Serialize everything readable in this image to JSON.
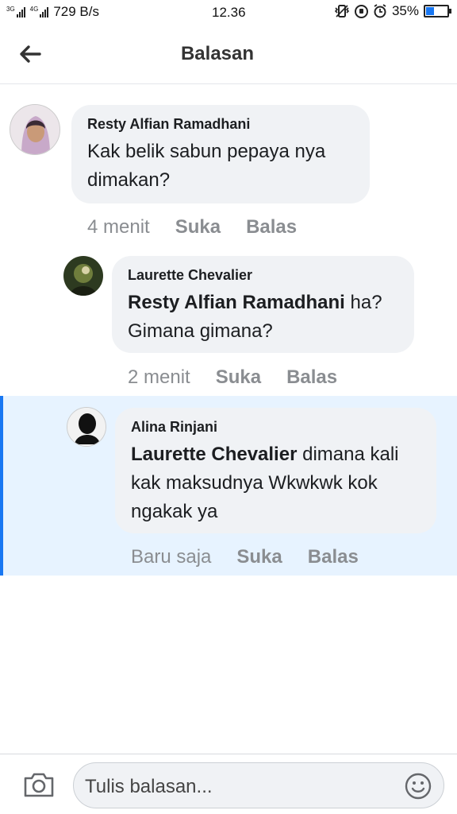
{
  "status_bar": {
    "net_label_1": "3G",
    "net_label_2": "4G",
    "speed": "729 B/s",
    "time": "12.36",
    "battery_text": "35%",
    "battery_level": 0.35
  },
  "header": {
    "title": "Balasan"
  },
  "comments": [
    {
      "author": "Resty Alfian Ramadhani",
      "mention": "",
      "text": "Kak belik sabun pepaya nya dimakan?",
      "time": "4 menit",
      "like_label": "Suka",
      "reply_label": "Balas"
    },
    {
      "author": "Laurette Chevalier",
      "mention": "Resty Alfian Ramadhani",
      "text": " ha? Gimana gimana?",
      "time": "2 menit",
      "like_label": "Suka",
      "reply_label": "Balas"
    },
    {
      "author": "Alina Rinjani",
      "mention": "Laurette Chevalier",
      "text": " dimana kali kak maksudnya Wkwkwk kok ngakak ya",
      "time": "Baru saja",
      "like_label": "Suka",
      "reply_label": "Balas"
    }
  ],
  "composer": {
    "placeholder": "Tulis balasan..."
  },
  "colors": {
    "accent": "#1877f2",
    "highlight_bg": "#e7f3ff",
    "bubble_bg": "#f0f2f5",
    "meta_text": "#8a8d91"
  },
  "icons": {
    "back": "arrow-left-icon",
    "camera": "camera-icon",
    "emoji": "smiley-icon"
  }
}
